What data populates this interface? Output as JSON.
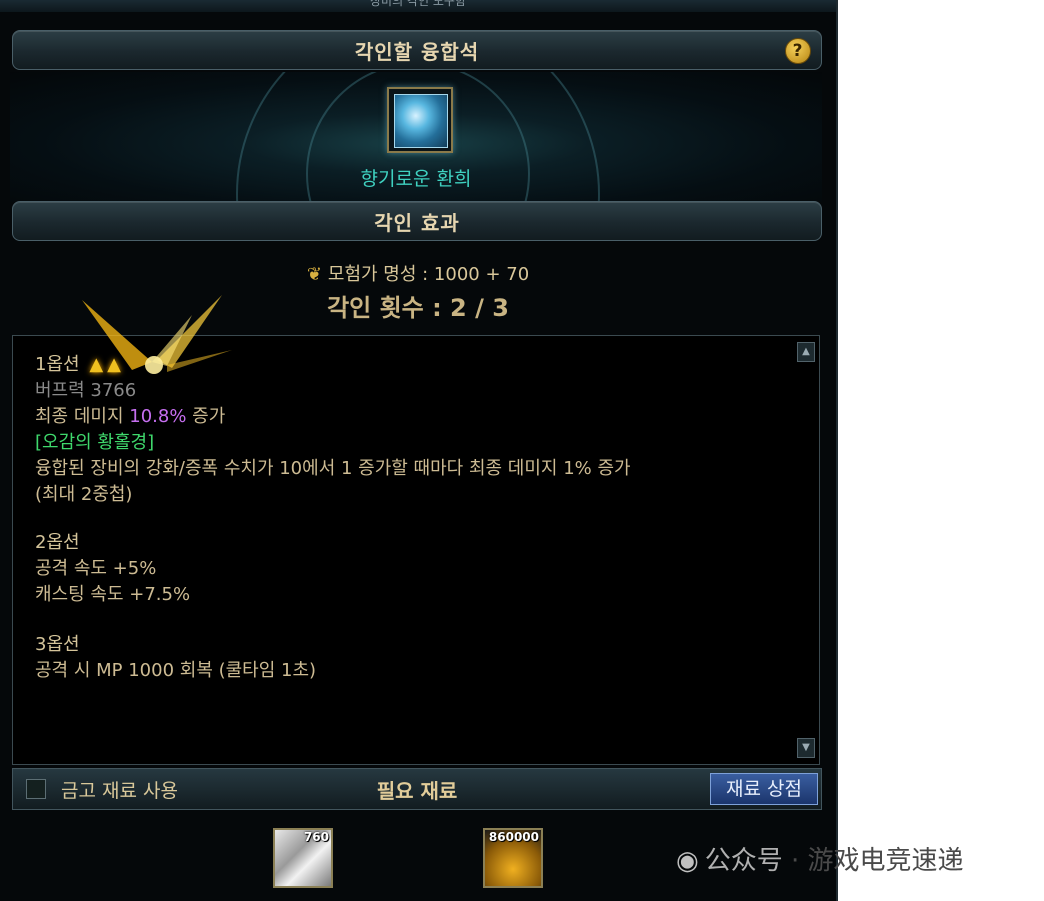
{
  "window": {
    "title": "장비의 각인 도구함",
    "close_icon": "close-icon"
  },
  "stone_section": {
    "title": "각인할 융합석",
    "help_label": "?",
    "item_name": "향기로운 환희"
  },
  "effect_section": {
    "title": "각인 효과",
    "fame_label": "모험가 명성 : 1000 + 70",
    "count_label": "각인 횟수 : 2 / 3"
  },
  "options": {
    "opt1": {
      "title": "1옵션",
      "buff": "버프력 3766",
      "damage_prefix": "최종 데미지 ",
      "damage_value": "10.8%",
      "damage_suffix": " 증가",
      "set_name": "[오감의 황홀경]",
      "desc_line1": "융합된 장비의 강화/증폭 수치가 10에서 1 증가할 때마다 최종 데미지 1% 증가",
      "desc_line2": "(최대 2중첩)"
    },
    "opt2": {
      "title": "2옵션",
      "line1": "공격 속도 +5%",
      "line2": "캐스팅 속도 +7.5%"
    },
    "opt3": {
      "title": "3옵션",
      "line1": "공격 시 MP 1000 회복 (쿨타임 1초)"
    }
  },
  "bottom": {
    "checkbox_label": "금고 재료 사용",
    "required_title": "필요 재료",
    "shop_button": "재료 상점"
  },
  "materials": [
    {
      "count": "760"
    },
    {
      "count": "860000"
    }
  ],
  "watermark": {
    "prefix": "公众号",
    "name": "游戏电竞速递"
  }
}
